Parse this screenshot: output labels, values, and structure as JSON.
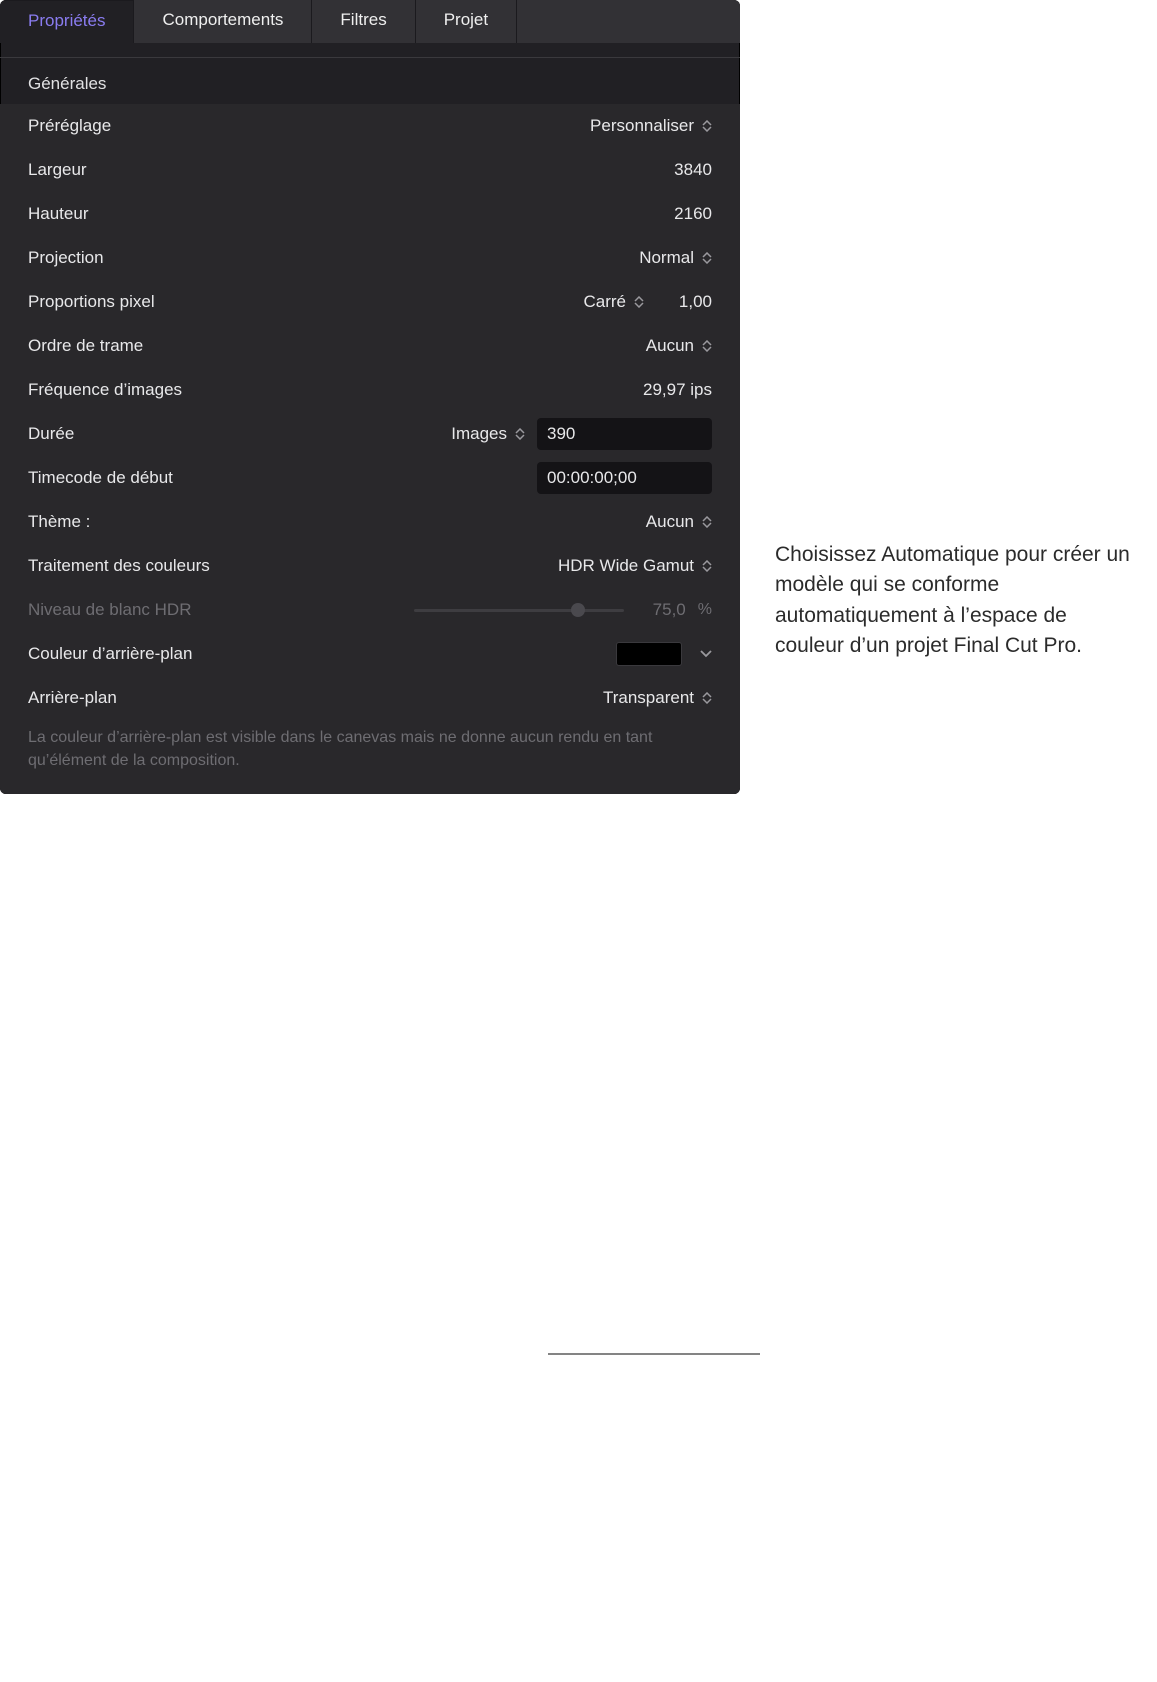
{
  "tabs": {
    "properties": "Propriétés",
    "behaviors": "Comportements",
    "filters": "Filtres",
    "project": "Projet"
  },
  "section": "Générales",
  "rows": {
    "preset": {
      "label": "Préréglage",
      "value": "Personnaliser"
    },
    "width": {
      "label": "Largeur",
      "value": "3840"
    },
    "height": {
      "label": "Hauteur",
      "value": "2160"
    },
    "projection": {
      "label": "Projection",
      "value": "Normal"
    },
    "pixel_aspect": {
      "label": "Proportions pixel",
      "value": "Carré",
      "ratio": "1,00"
    },
    "field_order": {
      "label": "Ordre de trame",
      "value": "Aucun"
    },
    "frame_rate": {
      "label": "Fréquence d’images",
      "value": "29,97 ips"
    },
    "duration": {
      "label": "Durée",
      "unit": "Images",
      "value": "390"
    },
    "start_tc": {
      "label": "Timecode de début",
      "value": "00:00:00;00"
    },
    "theme": {
      "label": "Thème :",
      "value": "Aucun"
    },
    "color_processing": {
      "label": "Traitement des couleurs",
      "value": "HDR Wide Gamut"
    },
    "hdr_white": {
      "label": "Niveau de blanc HDR",
      "value": "75,0",
      "unit": "%"
    },
    "bg_color": {
      "label": "Couleur d’arrière-plan"
    },
    "background": {
      "label": "Arrière-plan",
      "value": "Transparent"
    }
  },
  "note": "La couleur d’arrière-plan est visible dans le canevas mais ne donne aucun rendu en tant qu’élément de la composition.",
  "callout": "Choisissez Automatique pour créer un modèle qui se conforme automatiquement à l’espace de couleur d’un projet Final Cut Pro."
}
